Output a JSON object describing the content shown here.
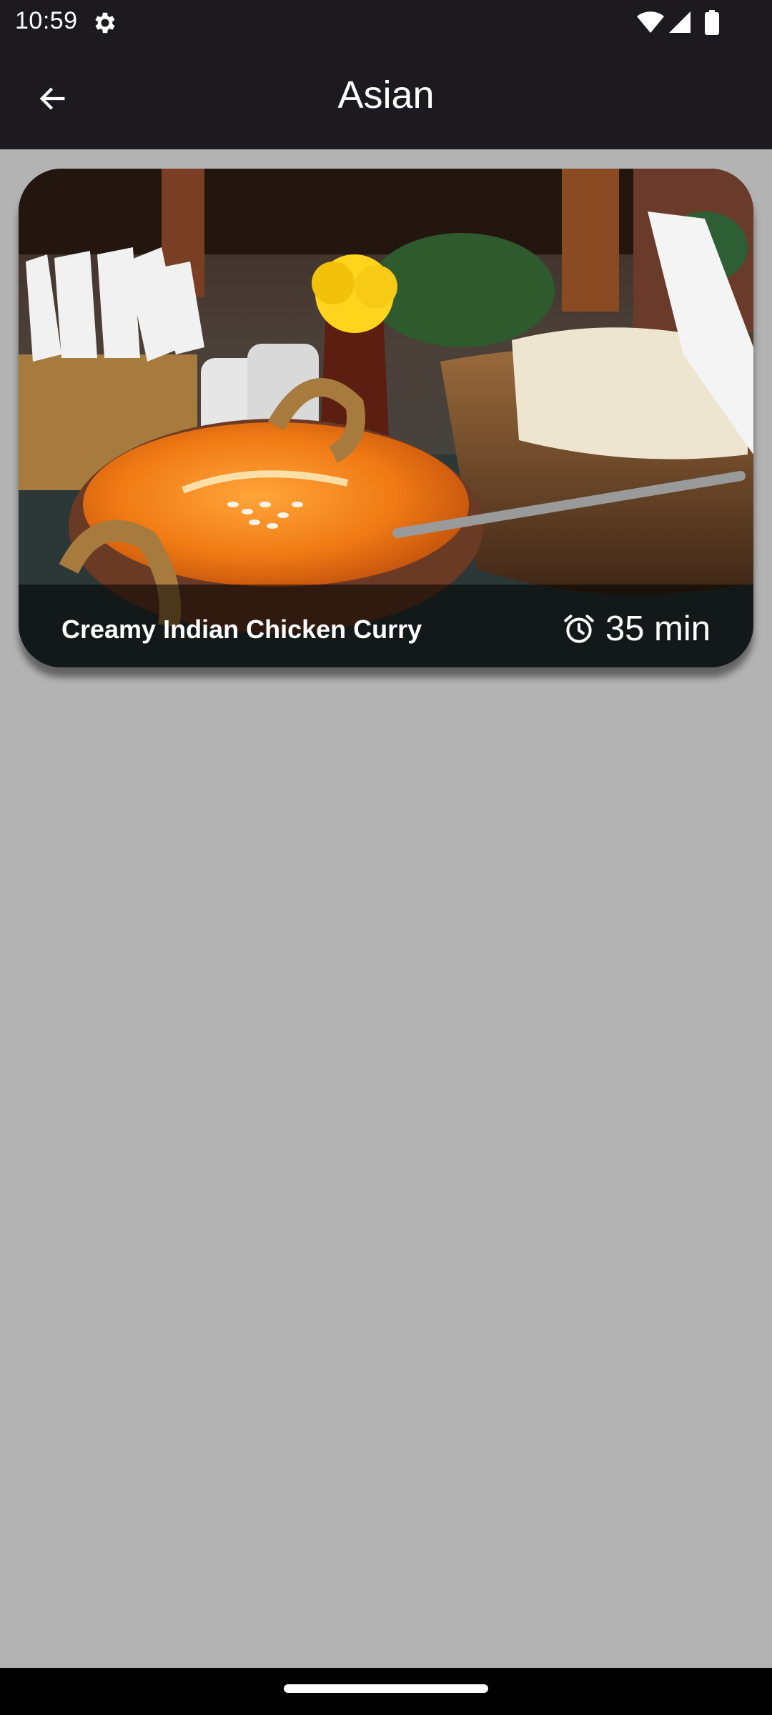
{
  "status_bar": {
    "time": "10:59",
    "icons": [
      "settings-gear-icon",
      "wifi-icon",
      "cellular-signal-icon",
      "battery-icon"
    ]
  },
  "app_bar": {
    "title": "Asian",
    "back_icon": "arrow-back-icon"
  },
  "recipes": [
    {
      "title": "Creamy Indian Chicken Curry",
      "duration": "35 min",
      "duration_icon": "alarm-clock-icon",
      "image_description": "photo"
    }
  ],
  "colors": {
    "app_bar": "#1d1a1f",
    "background": "#b3b3b3",
    "text_on_dark": "#ffffff"
  }
}
